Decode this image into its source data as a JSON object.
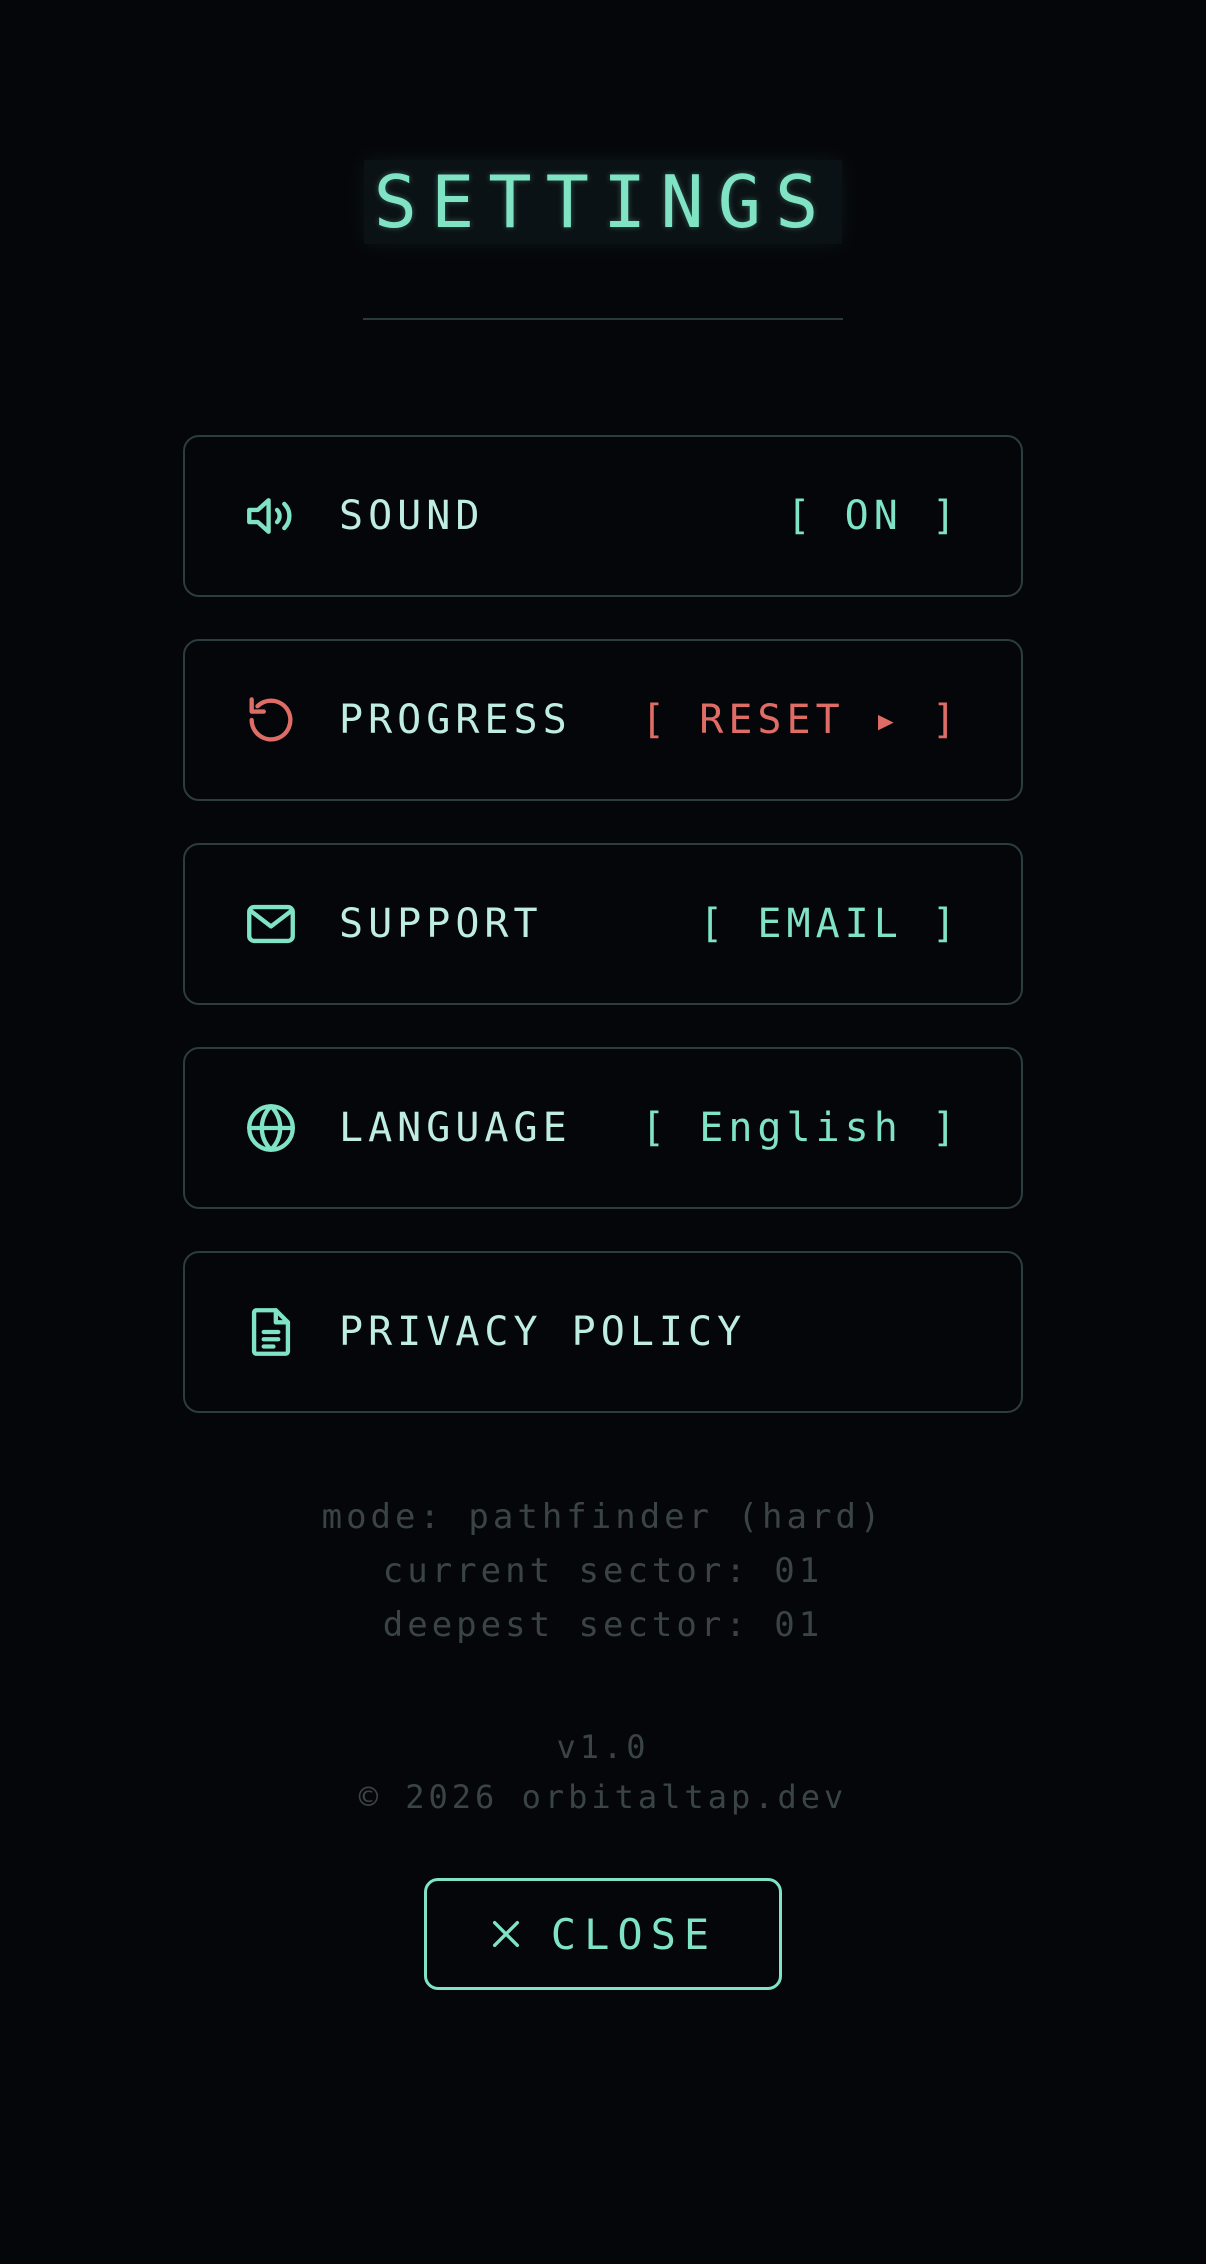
{
  "header": {
    "title": "SETTINGS"
  },
  "colors": {
    "accent": "#7fe3c4",
    "danger": "#e06c66",
    "muted": "#3a4446",
    "border": "#2c3c3f",
    "background": "#05060a"
  },
  "settings": {
    "items": [
      {
        "icon": "speaker-icon",
        "label": "SOUND",
        "value": "[ ON ]"
      },
      {
        "icon": "reset-icon",
        "label": "PROGRESS",
        "value": "[ RESET ▸ ]"
      },
      {
        "icon": "mail-icon",
        "label": "SUPPORT",
        "value": "[ EMAIL ]"
      },
      {
        "icon": "globe-icon",
        "label": "LANGUAGE",
        "value": "[ English ]"
      },
      {
        "icon": "document-icon",
        "label": "PRIVACY POLICY",
        "value": ""
      }
    ]
  },
  "meta": {
    "mode": "mode: pathfinder (hard)",
    "current_sector": "current sector: 01",
    "deepest_sector": "deepest sector: 01"
  },
  "footer": {
    "version": "v1.0",
    "copyright": "© 2026 orbitaltap.dev"
  },
  "close_button": {
    "icon": "close-icon",
    "label": "CLOSE"
  }
}
